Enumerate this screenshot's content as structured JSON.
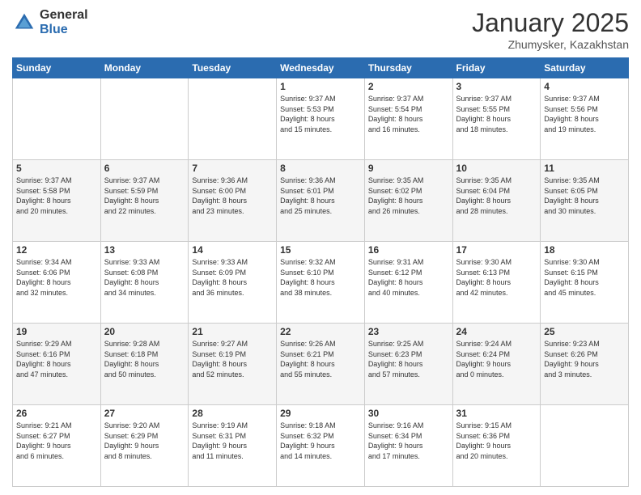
{
  "logo": {
    "general": "General",
    "blue": "Blue"
  },
  "header": {
    "month": "January 2025",
    "location": "Zhumysker, Kazakhstan"
  },
  "weekdays": [
    "Sunday",
    "Monday",
    "Tuesday",
    "Wednesday",
    "Thursday",
    "Friday",
    "Saturday"
  ],
  "weeks": [
    [
      {
        "day": "",
        "info": ""
      },
      {
        "day": "",
        "info": ""
      },
      {
        "day": "",
        "info": ""
      },
      {
        "day": "1",
        "info": "Sunrise: 9:37 AM\nSunset: 5:53 PM\nDaylight: 8 hours\nand 15 minutes."
      },
      {
        "day": "2",
        "info": "Sunrise: 9:37 AM\nSunset: 5:54 PM\nDaylight: 8 hours\nand 16 minutes."
      },
      {
        "day": "3",
        "info": "Sunrise: 9:37 AM\nSunset: 5:55 PM\nDaylight: 8 hours\nand 18 minutes."
      },
      {
        "day": "4",
        "info": "Sunrise: 9:37 AM\nSunset: 5:56 PM\nDaylight: 8 hours\nand 19 minutes."
      }
    ],
    [
      {
        "day": "5",
        "info": "Sunrise: 9:37 AM\nSunset: 5:58 PM\nDaylight: 8 hours\nand 20 minutes."
      },
      {
        "day": "6",
        "info": "Sunrise: 9:37 AM\nSunset: 5:59 PM\nDaylight: 8 hours\nand 22 minutes."
      },
      {
        "day": "7",
        "info": "Sunrise: 9:36 AM\nSunset: 6:00 PM\nDaylight: 8 hours\nand 23 minutes."
      },
      {
        "day": "8",
        "info": "Sunrise: 9:36 AM\nSunset: 6:01 PM\nDaylight: 8 hours\nand 25 minutes."
      },
      {
        "day": "9",
        "info": "Sunrise: 9:35 AM\nSunset: 6:02 PM\nDaylight: 8 hours\nand 26 minutes."
      },
      {
        "day": "10",
        "info": "Sunrise: 9:35 AM\nSunset: 6:04 PM\nDaylight: 8 hours\nand 28 minutes."
      },
      {
        "day": "11",
        "info": "Sunrise: 9:35 AM\nSunset: 6:05 PM\nDaylight: 8 hours\nand 30 minutes."
      }
    ],
    [
      {
        "day": "12",
        "info": "Sunrise: 9:34 AM\nSunset: 6:06 PM\nDaylight: 8 hours\nand 32 minutes."
      },
      {
        "day": "13",
        "info": "Sunrise: 9:33 AM\nSunset: 6:08 PM\nDaylight: 8 hours\nand 34 minutes."
      },
      {
        "day": "14",
        "info": "Sunrise: 9:33 AM\nSunset: 6:09 PM\nDaylight: 8 hours\nand 36 minutes."
      },
      {
        "day": "15",
        "info": "Sunrise: 9:32 AM\nSunset: 6:10 PM\nDaylight: 8 hours\nand 38 minutes."
      },
      {
        "day": "16",
        "info": "Sunrise: 9:31 AM\nSunset: 6:12 PM\nDaylight: 8 hours\nand 40 minutes."
      },
      {
        "day": "17",
        "info": "Sunrise: 9:30 AM\nSunset: 6:13 PM\nDaylight: 8 hours\nand 42 minutes."
      },
      {
        "day": "18",
        "info": "Sunrise: 9:30 AM\nSunset: 6:15 PM\nDaylight: 8 hours\nand 45 minutes."
      }
    ],
    [
      {
        "day": "19",
        "info": "Sunrise: 9:29 AM\nSunset: 6:16 PM\nDaylight: 8 hours\nand 47 minutes."
      },
      {
        "day": "20",
        "info": "Sunrise: 9:28 AM\nSunset: 6:18 PM\nDaylight: 8 hours\nand 50 minutes."
      },
      {
        "day": "21",
        "info": "Sunrise: 9:27 AM\nSunset: 6:19 PM\nDaylight: 8 hours\nand 52 minutes."
      },
      {
        "day": "22",
        "info": "Sunrise: 9:26 AM\nSunset: 6:21 PM\nDaylight: 8 hours\nand 55 minutes."
      },
      {
        "day": "23",
        "info": "Sunrise: 9:25 AM\nSunset: 6:23 PM\nDaylight: 8 hours\nand 57 minutes."
      },
      {
        "day": "24",
        "info": "Sunrise: 9:24 AM\nSunset: 6:24 PM\nDaylight: 9 hours\nand 0 minutes."
      },
      {
        "day": "25",
        "info": "Sunrise: 9:23 AM\nSunset: 6:26 PM\nDaylight: 9 hours\nand 3 minutes."
      }
    ],
    [
      {
        "day": "26",
        "info": "Sunrise: 9:21 AM\nSunset: 6:27 PM\nDaylight: 9 hours\nand 6 minutes."
      },
      {
        "day": "27",
        "info": "Sunrise: 9:20 AM\nSunset: 6:29 PM\nDaylight: 9 hours\nand 8 minutes."
      },
      {
        "day": "28",
        "info": "Sunrise: 9:19 AM\nSunset: 6:31 PM\nDaylight: 9 hours\nand 11 minutes."
      },
      {
        "day": "29",
        "info": "Sunrise: 9:18 AM\nSunset: 6:32 PM\nDaylight: 9 hours\nand 14 minutes."
      },
      {
        "day": "30",
        "info": "Sunrise: 9:16 AM\nSunset: 6:34 PM\nDaylight: 9 hours\nand 17 minutes."
      },
      {
        "day": "31",
        "info": "Sunrise: 9:15 AM\nSunset: 6:36 PM\nDaylight: 9 hours\nand 20 minutes."
      },
      {
        "day": "",
        "info": ""
      }
    ]
  ]
}
